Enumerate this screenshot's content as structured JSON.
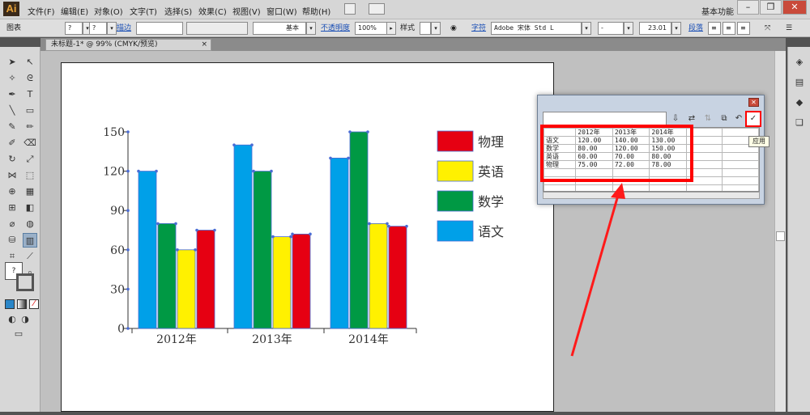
{
  "app": {
    "logo": "Ai"
  },
  "menu": [
    "文件(F)",
    "编辑(E)",
    "对象(O)",
    "文字(T)",
    "选择(S)",
    "效果(C)",
    "视图(V)",
    "窗口(W)",
    "帮助(H)"
  ],
  "workspace": "基本功能",
  "control": {
    "object_type": "图表",
    "stroke_label": "描边",
    "stroke_style": "基本",
    "opacity_label": "不透明度",
    "opacity_value": "100%",
    "style_label": "样式",
    "char_label": "字符",
    "font_name": "Adobe 宋体 Std L",
    "font_style": "-",
    "font_size": "23.01",
    "para_label": "段落",
    "q1": "?",
    "q2": "?"
  },
  "document_tab": "未标题-1* @ 99% (CMYK/预览)",
  "chart_data": {
    "type": "bar",
    "categories": [
      "2012年",
      "2013年",
      "2014年"
    ],
    "series": [
      {
        "name": "语文",
        "values": [
          120,
          140,
          130
        ],
        "color": "#00a0e8"
      },
      {
        "name": "数学",
        "values": [
          80,
          120,
          150
        ],
        "color": "#009944"
      },
      {
        "name": "英语",
        "values": [
          60,
          70,
          80
        ],
        "color": "#fff100"
      },
      {
        "name": "物理",
        "values": [
          75,
          72,
          78
        ],
        "color": "#e60012"
      }
    ],
    "yticks": [
      "0",
      "30",
      "60",
      "90",
      "120",
      "150"
    ],
    "ylim": [
      0,
      150
    ],
    "legend_order": [
      "物理",
      "英语",
      "数学",
      "语文"
    ],
    "legend_position": "right"
  },
  "graph_data_dialog": {
    "headers": [
      "",
      "2012年",
      "2013年",
      "2014年",
      "",
      ""
    ],
    "rows": [
      [
        "语文",
        "120.00",
        "140.00",
        "130.00",
        "",
        ""
      ],
      [
        "数学",
        "80.00",
        "120.00",
        "150.00",
        "",
        ""
      ],
      [
        "英语",
        "60.00",
        "70.00",
        "80.00",
        "",
        ""
      ],
      [
        "物理",
        "75.00",
        "72.00",
        "78.00",
        "",
        ""
      ],
      [
        "",
        "",
        "",
        "",
        "",
        ""
      ],
      [
        "",
        "",
        "",
        "",
        "",
        ""
      ],
      [
        "",
        "",
        "",
        "",
        "",
        ""
      ]
    ],
    "apply_tooltip": "应用",
    "highlight_color": "#ff0000"
  },
  "colors": {
    "annotation": "#ff1a1a",
    "selection": "#4a6cd4"
  }
}
